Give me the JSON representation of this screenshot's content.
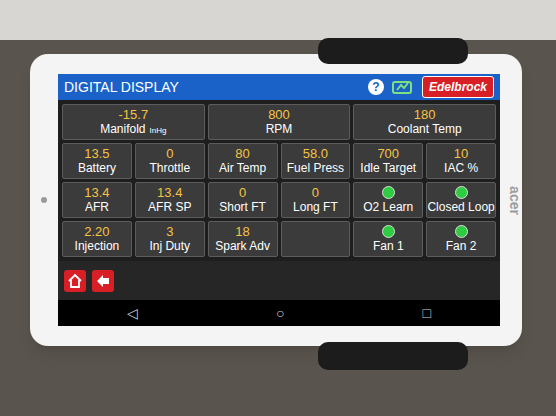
{
  "device": {
    "brand": "acer"
  },
  "app": {
    "title": "DIGITAL DISPLAY",
    "help": "?",
    "logo": "Edelbrock"
  },
  "top_gauges": [
    {
      "value": "-15.7",
      "label": "Manifold",
      "unit": "InHg"
    },
    {
      "value": "800",
      "label": "RPM"
    },
    {
      "value": "180",
      "label": "Coolant Temp"
    }
  ],
  "gauges": [
    {
      "kind": "value",
      "value": "13.5",
      "label": "Battery"
    },
    {
      "kind": "value",
      "value": "0",
      "label": "Throttle"
    },
    {
      "kind": "value",
      "value": "80",
      "label": "Air Temp"
    },
    {
      "kind": "value",
      "value": "58.0",
      "label": "Fuel Press"
    },
    {
      "kind": "value",
      "value": "700",
      "label": "Idle Target"
    },
    {
      "kind": "value",
      "value": "10",
      "label": "IAC %"
    },
    {
      "kind": "value",
      "value": "13.4",
      "label": "AFR"
    },
    {
      "kind": "value",
      "value": "13.4",
      "label": "AFR SP"
    },
    {
      "kind": "value",
      "value": "0",
      "label": "Short FT"
    },
    {
      "kind": "value",
      "value": "0",
      "label": "Long FT"
    },
    {
      "kind": "indicator",
      "label": "O2 Learn",
      "on": true
    },
    {
      "kind": "indicator",
      "label": "Closed Loop",
      "on": true
    },
    {
      "kind": "value",
      "value": "2.20",
      "label": "Injection"
    },
    {
      "kind": "value",
      "value": "3",
      "label": "Inj Duty"
    },
    {
      "kind": "value",
      "value": "18",
      "label": "Spark Adv"
    },
    {
      "kind": "empty"
    },
    {
      "kind": "indicator",
      "label": "Fan 1",
      "on": true
    },
    {
      "kind": "indicator",
      "label": "Fan 2",
      "on": true
    }
  ],
  "nav": [
    "◁",
    "○",
    "□"
  ]
}
